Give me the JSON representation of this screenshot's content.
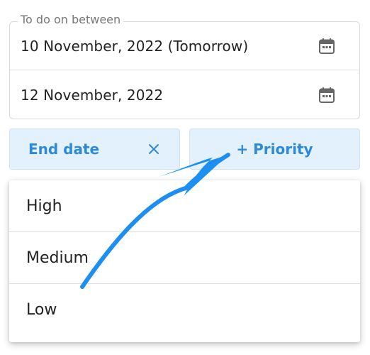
{
  "date_range": {
    "legend": "To do on between",
    "start_date": "10 November, 2022 (Tomorrow)",
    "end_date": "12 November, 2022",
    "calendar_icon": "calendar-icon"
  },
  "chips": {
    "end_date_label": "End date",
    "end_date_remove_icon": "close-icon",
    "priority_label": "+ Priority"
  },
  "priority_menu": {
    "options": [
      "High",
      "Medium",
      "Low"
    ]
  },
  "colors": {
    "accent": "#2e8ad8",
    "chip_background": "#e3f1fd",
    "annotation_arrow": "#1d8ff0"
  }
}
